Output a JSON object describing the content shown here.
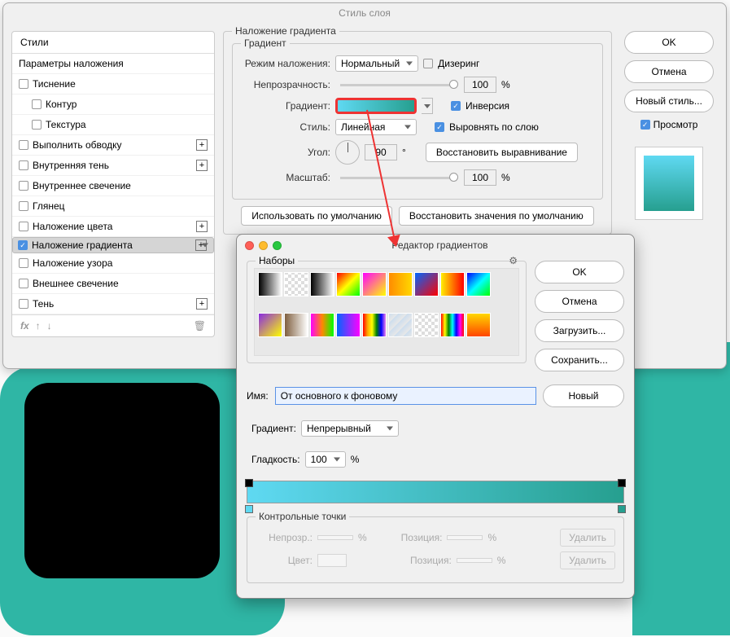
{
  "layer_style": {
    "title": "Стиль слоя",
    "styles_header": "Стили",
    "blending_options": "Параметры наложения",
    "items": [
      {
        "label": "Тиснение",
        "has_plus": false,
        "checked": false
      },
      {
        "label": "Контур",
        "sub": true,
        "checked": false
      },
      {
        "label": "Текстура",
        "sub": true,
        "checked": false
      },
      {
        "label": "Выполнить обводку",
        "has_plus": true,
        "checked": false
      },
      {
        "label": "Внутренняя тень",
        "has_plus": true,
        "checked": false
      },
      {
        "label": "Внутреннее свечение",
        "checked": false
      },
      {
        "label": "Глянец",
        "checked": false
      },
      {
        "label": "Наложение цвета",
        "has_plus": true,
        "checked": false
      },
      {
        "label": "Наложение градиента",
        "has_plus": true,
        "checked": true,
        "selected": true
      },
      {
        "label": "Наложение узора",
        "checked": false
      },
      {
        "label": "Внешнее свечение",
        "checked": false
      },
      {
        "label": "Тень",
        "has_plus": true,
        "checked": false
      }
    ],
    "fx_label": "fx"
  },
  "gradient_overlay": {
    "group_title": "Наложение градиента",
    "subgroup_title": "Градиент",
    "blend_mode_label": "Режим наложения:",
    "blend_mode_value": "Нормальный",
    "dither_label": "Дизеринг",
    "opacity_label": "Непрозрачность:",
    "opacity_value": "100",
    "percent": "%",
    "gradient_label": "Градиент:",
    "reverse_label": "Инверсия",
    "style_label": "Стиль:",
    "style_value": "Линейная",
    "align_label": "Выровнять по слою",
    "angle_label": "Угол:",
    "angle_value": "90",
    "degree": "°",
    "reset_align": "Восстановить выравнивание",
    "scale_label": "Масштаб:",
    "scale_value": "100",
    "make_default": "Использовать по умолчанию",
    "reset_default": "Восстановить значения по умолчанию"
  },
  "right": {
    "ok": "OK",
    "cancel": "Отмена",
    "new_style": "Новый стиль...",
    "preview": "Просмотр"
  },
  "editor": {
    "title": "Редактор градиентов",
    "presets_label": "Наборы",
    "ok": "OK",
    "cancel": "Отмена",
    "load": "Загрузить...",
    "save": "Сохранить...",
    "new": "Новый",
    "name_label": "Имя:",
    "name_value": "От основного к фоновому",
    "type_label": "Градиент:",
    "type_value": "Непрерывный",
    "smooth_label": "Гладкость:",
    "smooth_value": "100",
    "percent": "%",
    "stops_title": "Контрольные точки",
    "opacity_label": "Непрозр.:",
    "position_label": "Позиция:",
    "color_label": "Цвет:",
    "delete": "Удалить"
  },
  "preset_swatches": [
    "linear-gradient(90deg,#000,#fff)",
    "repeating-conic-gradient(#ddd 0 25%,#fff 0 50%) 0/8px 8px",
    "linear-gradient(90deg,#000,#fff)",
    "linear-gradient(135deg,#f00,#ff0,#0f0)",
    "linear-gradient(135deg,#f0f,#ff0)",
    "linear-gradient(90deg,#ff8c00,#ffd700)",
    "linear-gradient(135deg,#06f,#f00)",
    "linear-gradient(90deg,#fe0,#f00)",
    "linear-gradient(135deg,#00f,#0ff,#0f0)",
    "linear-gradient(135deg,#8a2be2,#ff0)",
    "linear-gradient(90deg,#806040,#fff)",
    "linear-gradient(90deg,#f0f,#f80,#0f0)",
    "linear-gradient(90deg,#06f,#f0f)",
    "linear-gradient(90deg,red,orange,yellow,green,blue,violet)",
    "repeating-linear-gradient(135deg,#cde,transparent 8px)",
    "repeating-conic-gradient(#ddd 0 25%,#fff 0 50%) 0/8px 8px",
    "linear-gradient(90deg,red,yellow,green,cyan,blue,magenta,red)",
    "linear-gradient(180deg,#ffd700,#ff4500)"
  ]
}
